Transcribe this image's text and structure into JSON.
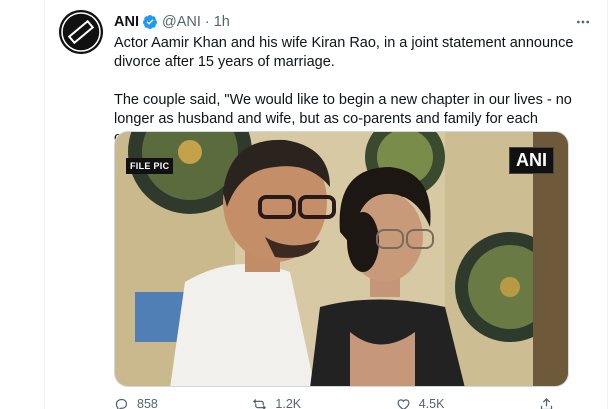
{
  "tweet": {
    "name": "ANI",
    "handle": "@ANI",
    "separator": "·",
    "time": "1h",
    "paragraph1": "Actor Aamir Khan and his wife Kiran Rao, in a joint statement announce divorce after 15 years of marriage.",
    "paragraph2": "The couple said, \"We would like to begin a new chapter in our lives - no longer as husband and wife, but as co-parents and family for each other.\""
  },
  "media": {
    "file_pic_label": "FILE PIC",
    "watermark": "ANI"
  },
  "actions": {
    "reply_count": "858",
    "retweet_count": "1.2K",
    "like_count": "4.5K"
  },
  "colors": {
    "verified": "#1d9bf0",
    "muted": "#536471",
    "text": "#0f1419"
  },
  "icons": [
    "ani-logo-icon",
    "verified-icon",
    "more-icon",
    "reply-icon",
    "retweet-icon",
    "like-icon",
    "share-icon"
  ]
}
